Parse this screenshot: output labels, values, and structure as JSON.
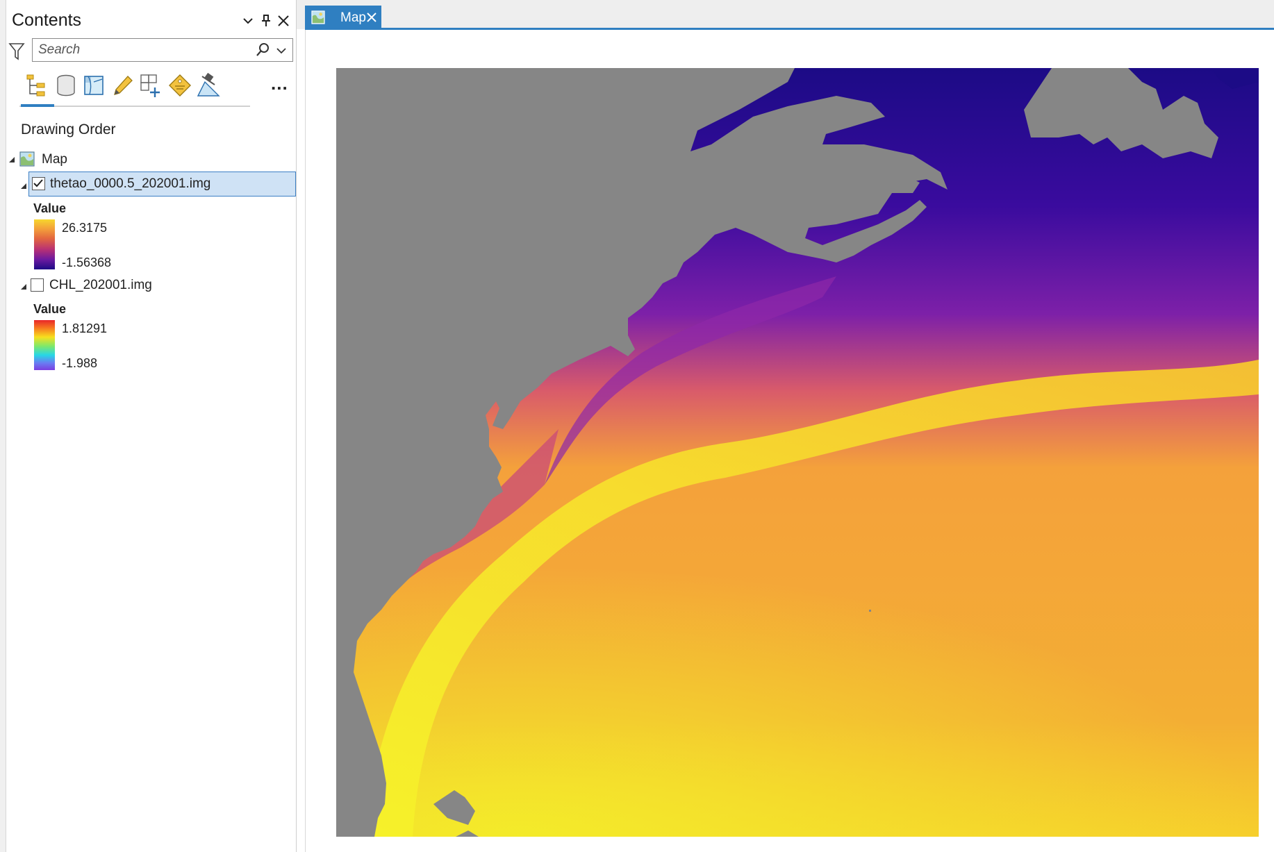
{
  "contents": {
    "title": "Contents",
    "search": {
      "placeholder": "Search",
      "value": ""
    },
    "section_title": "Drawing Order",
    "map_node": {
      "label": "Map"
    },
    "layers": [
      {
        "name": "thetao_0000.5_202001.img",
        "checked": true,
        "selected": true,
        "legend": {
          "heading": "Value",
          "max": "26.3175",
          "min": "-1.56368",
          "ramp": "plasma"
        }
      },
      {
        "name": "CHL_202001.img",
        "checked": false,
        "selected": false,
        "legend": {
          "heading": "Value",
          "max": "1.81291",
          "min": "-1.988",
          "ramp": "spectral"
        }
      }
    ],
    "toolbar_icons": [
      "list-by-drawing-order-icon",
      "list-by-data-source-icon",
      "list-by-selection-icon",
      "list-by-editing-icon",
      "list-by-snapping-icon",
      "list-by-labeling-icon",
      "list-by-perspective-imagery-icon",
      "more-options-icon"
    ],
    "more_label": "..."
  },
  "map_tab": {
    "label": "Map"
  },
  "colors": {
    "accent": "#2f7fc1",
    "land": "#868686",
    "selection": "#cfe2f5"
  }
}
